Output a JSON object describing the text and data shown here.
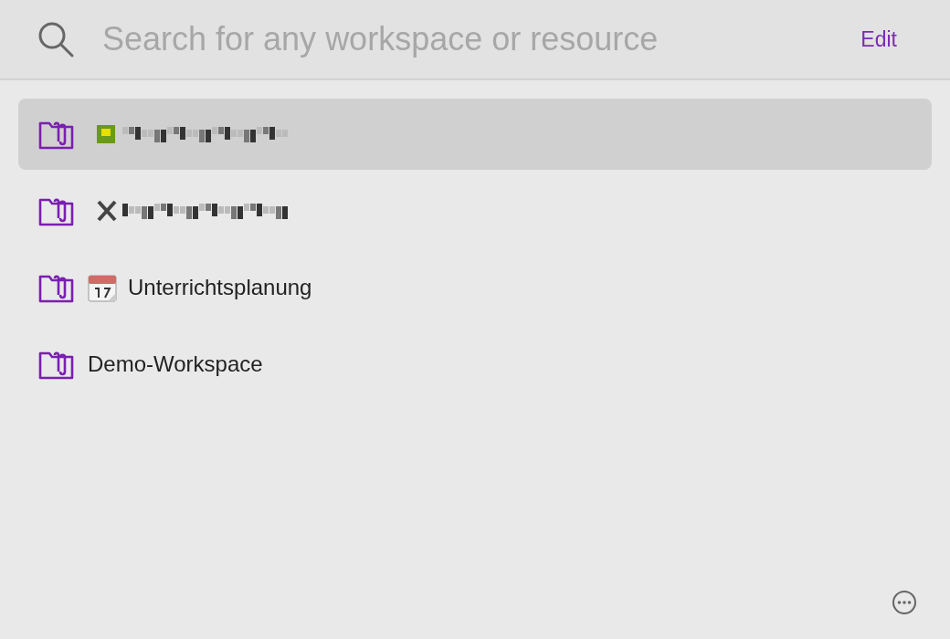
{
  "search": {
    "placeholder": "Search for any workspace or resource"
  },
  "edit_button": "Edit",
  "workspaces": [
    {
      "kind": "redacted",
      "selected": true
    },
    {
      "kind": "redacted",
      "selected": false
    },
    {
      "kind": "calendar",
      "label": "Unterrichtsplanung",
      "selected": false
    },
    {
      "kind": "named",
      "label": "Demo-Workspace",
      "selected": false
    }
  ]
}
